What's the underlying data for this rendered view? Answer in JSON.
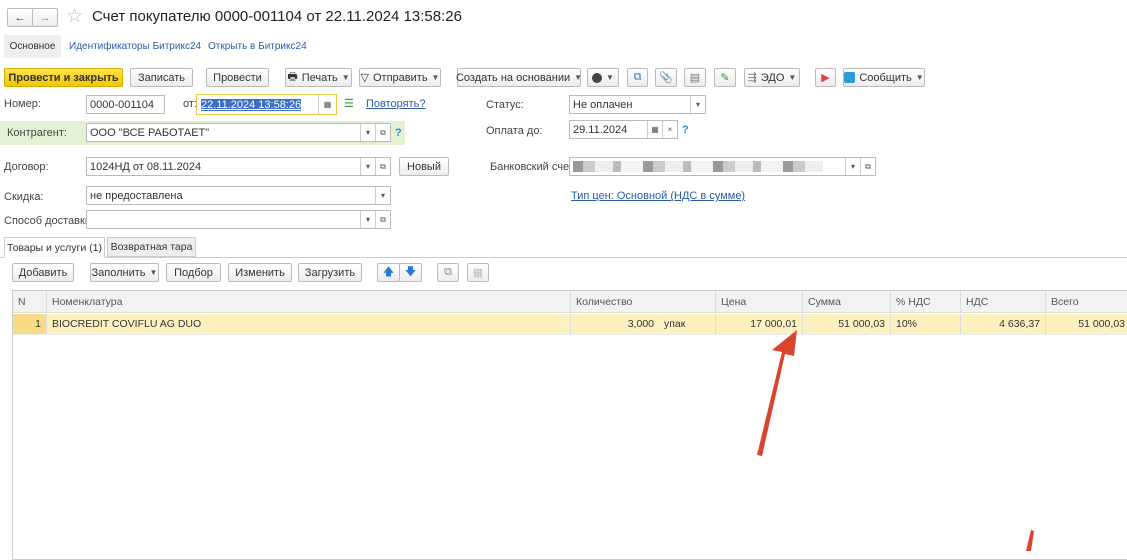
{
  "title": "Счет покупателю 0000-001104 от 22.11.2024 13:58:26",
  "nav": {
    "back": "←",
    "forward": "→",
    "star": "☆"
  },
  "tabs_top": [
    "Основное",
    "Идентификаторы Битрикс24",
    "Открыть в Битрикс24"
  ],
  "toolbar": {
    "post_close": "Провести и закрыть",
    "save": "Записать",
    "post": "Провести",
    "print": "Печать",
    "send": "Отправить",
    "create_based": "Создать на основании",
    "edo": "ЭДО",
    "report": "Сообщить"
  },
  "form": {
    "number_label": "Номер:",
    "number": "0000-001104",
    "from_label": "от:",
    "date": "22.11.2024 13:58:26",
    "repeat_link": "Повторять?",
    "counterparty_label": "Контрагент:",
    "counterparty": "ООО \"ВСЕ РАБОТАЕТ\"",
    "contract_label": "Договор:",
    "contract": "1024НД от 08.11.2024",
    "new_button": "Новый",
    "discount_label": "Скидка:",
    "discount": "не предоставлена",
    "delivery_label": "Способ доставки:",
    "delivery": "",
    "status_label": "Статус:",
    "status": "Не оплачен",
    "pay_until_label": "Оплата до:",
    "pay_until": "29.11.2024",
    "bank_label": "Банковский счет:",
    "price_type_link": "Тип цен: Основной (НДС в сумме)",
    "help": "?"
  },
  "tabs_bottom": [
    "Товары и услуги (1)",
    "Возвратная тара"
  ],
  "table_toolbar": {
    "add": "Добавить",
    "fill": "Заполнить",
    "pick": "Подбор",
    "edit": "Изменить",
    "load": "Загрузить"
  },
  "table": {
    "columns": [
      "N",
      "Номенклатура",
      "Количество",
      "Цена",
      "Сумма",
      "% НДС",
      "НДС",
      "Всего"
    ],
    "rows": [
      {
        "n": "1",
        "item": "BIOCREDIT COVIFLU AG DUO",
        "qty": "3,000",
        "unit": "упак",
        "price": "17 000,01",
        "sum": "51 000,03",
        "vat_rate": "10%",
        "vat": "4 636,37",
        "total": "51 000,03"
      }
    ]
  },
  "colors": {
    "accent_yellow": "#f5cc00",
    "row_highlight": "#fdf1c0",
    "arrow": "#d9442f",
    "counterparty_bg": "#e3f2d4"
  }
}
